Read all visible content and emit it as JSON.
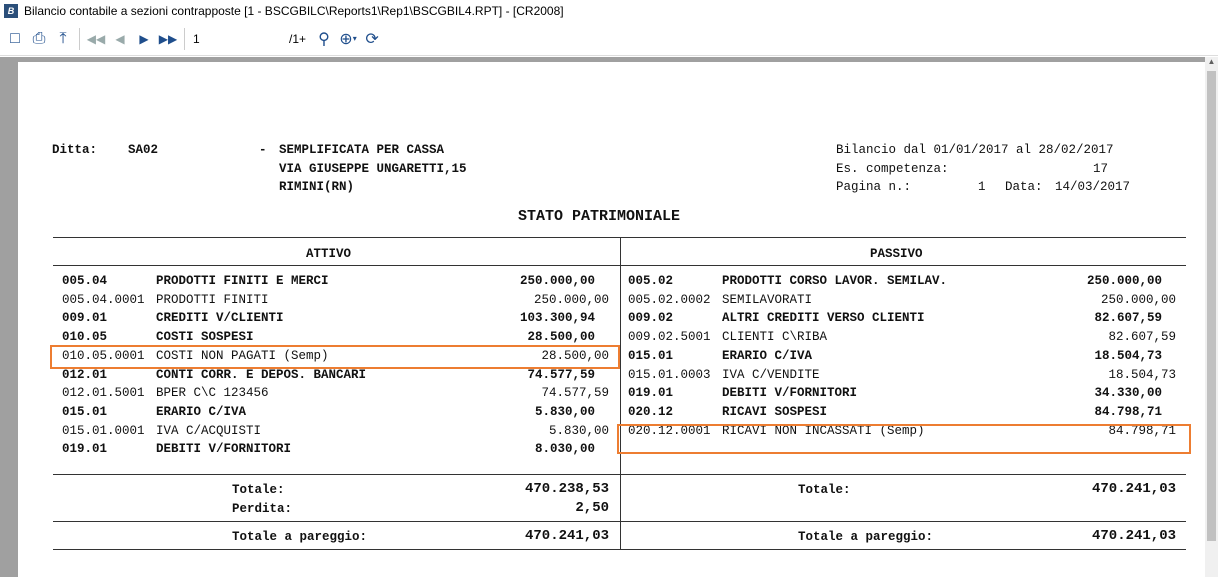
{
  "window": {
    "title": "Bilancio contabile a sezioni contrapposte [1 - BSCGBILC\\Reports1\\Rep1\\BSCGBIL4.RPT] - [CR2008]"
  },
  "toolbar": {
    "page_value": "1",
    "page_count": "/1+"
  },
  "header": {
    "ditta_label": "Ditta:",
    "ditta_code": "SA02",
    "dash": "-",
    "company_name": "SEMPLIFICATA PER CASSA",
    "address": "VIA GIUSEPPE UNGARETTI,15",
    "city": "RIMINI(RN)",
    "period": "Bilancio dal 01/01/2017 al 28/02/2017",
    "competenza_label": "Es. competenza:",
    "competenza_value": "17",
    "page_label": "Pagina n.:",
    "page_value": "1",
    "date_label": "Data:",
    "date_value": "14/03/2017"
  },
  "report_title": "STATO PATRIMONIALE",
  "attivo": {
    "heading": "ATTIVO",
    "rows": [
      {
        "code": "005.04",
        "desc": "PRODOTTI FINITI E MERCI",
        "amount": "250.000,00",
        "bold": true
      },
      {
        "code": "005.04.0001",
        "desc": "PRODOTTI FINITI",
        "amount": "250.000,00",
        "bold": false
      },
      {
        "code": "009.01",
        "desc": "CREDITI V/CLIENTI",
        "amount": "103.300,94",
        "bold": true
      },
      {
        "code": "010.05",
        "desc": "COSTI SOSPESI",
        "amount": "28.500,00",
        "bold": true
      },
      {
        "code": "010.05.0001",
        "desc": "COSTI NON PAGATI (Semp)",
        "amount": "28.500,00",
        "bold": false,
        "highlighted": true
      },
      {
        "code": "012.01",
        "desc": "CONTI CORR. E DEPOS. BANCARI",
        "amount": "74.577,59",
        "bold": true
      },
      {
        "code": "012.01.5001",
        "desc": "BPER C\\C 123456",
        "amount": "74.577,59",
        "bold": false
      },
      {
        "code": "015.01",
        "desc": "ERARIO C/IVA",
        "amount": "5.830,00",
        "bold": true
      },
      {
        "code": "015.01.0001",
        "desc": "IVA C/ACQUISTI",
        "amount": "5.830,00",
        "bold": false
      },
      {
        "code": "019.01",
        "desc": "DEBITI V/FORNITORI",
        "amount": "8.030,00",
        "bold": true
      }
    ],
    "totale_label": "Totale:",
    "totale": "470.238,53",
    "perdita_label": "Perdita:",
    "perdita": "2,50",
    "pareggio_label": "Totale a pareggio:",
    "pareggio": "470.241,03"
  },
  "passivo": {
    "heading": "PASSIVO",
    "rows": [
      {
        "code": "005.02",
        "desc": "PRODOTTI CORSO LAVOR. SEMILAV.",
        "amount": "250.000,00",
        "bold": true
      },
      {
        "code": "005.02.0002",
        "desc": "SEMILAVORATI",
        "amount": "250.000,00",
        "bold": false
      },
      {
        "code": "009.02",
        "desc": "ALTRI CREDITI VERSO CLIENTI",
        "amount": "82.607,59",
        "bold": true
      },
      {
        "code": "009.02.5001",
        "desc": "CLIENTI C\\RIBA",
        "amount": "82.607,59",
        "bold": false
      },
      {
        "code": "015.01",
        "desc": "ERARIO C/IVA",
        "amount": "18.504,73",
        "bold": true
      },
      {
        "code": "015.01.0003",
        "desc": "IVA C/VENDITE",
        "amount": "18.504,73",
        "bold": false
      },
      {
        "code": "019.01",
        "desc": "DEBITI V/FORNITORI",
        "amount": "34.330,00",
        "bold": true
      },
      {
        "code": "020.12",
        "desc": "RICAVI SOSPESI",
        "amount": "84.798,71",
        "bold": true
      },
      {
        "code": "020.12.0001",
        "desc": "RICAVI NON INCASSATI (Semp)",
        "amount": "84.798,71",
        "bold": false,
        "highlighted": true
      }
    ],
    "totale_label": "Totale:",
    "totale": "470.241,03",
    "pareggio_label": "Totale a pareggio:",
    "pareggio": "470.241,03"
  },
  "highlight_color": "#ed7d31"
}
